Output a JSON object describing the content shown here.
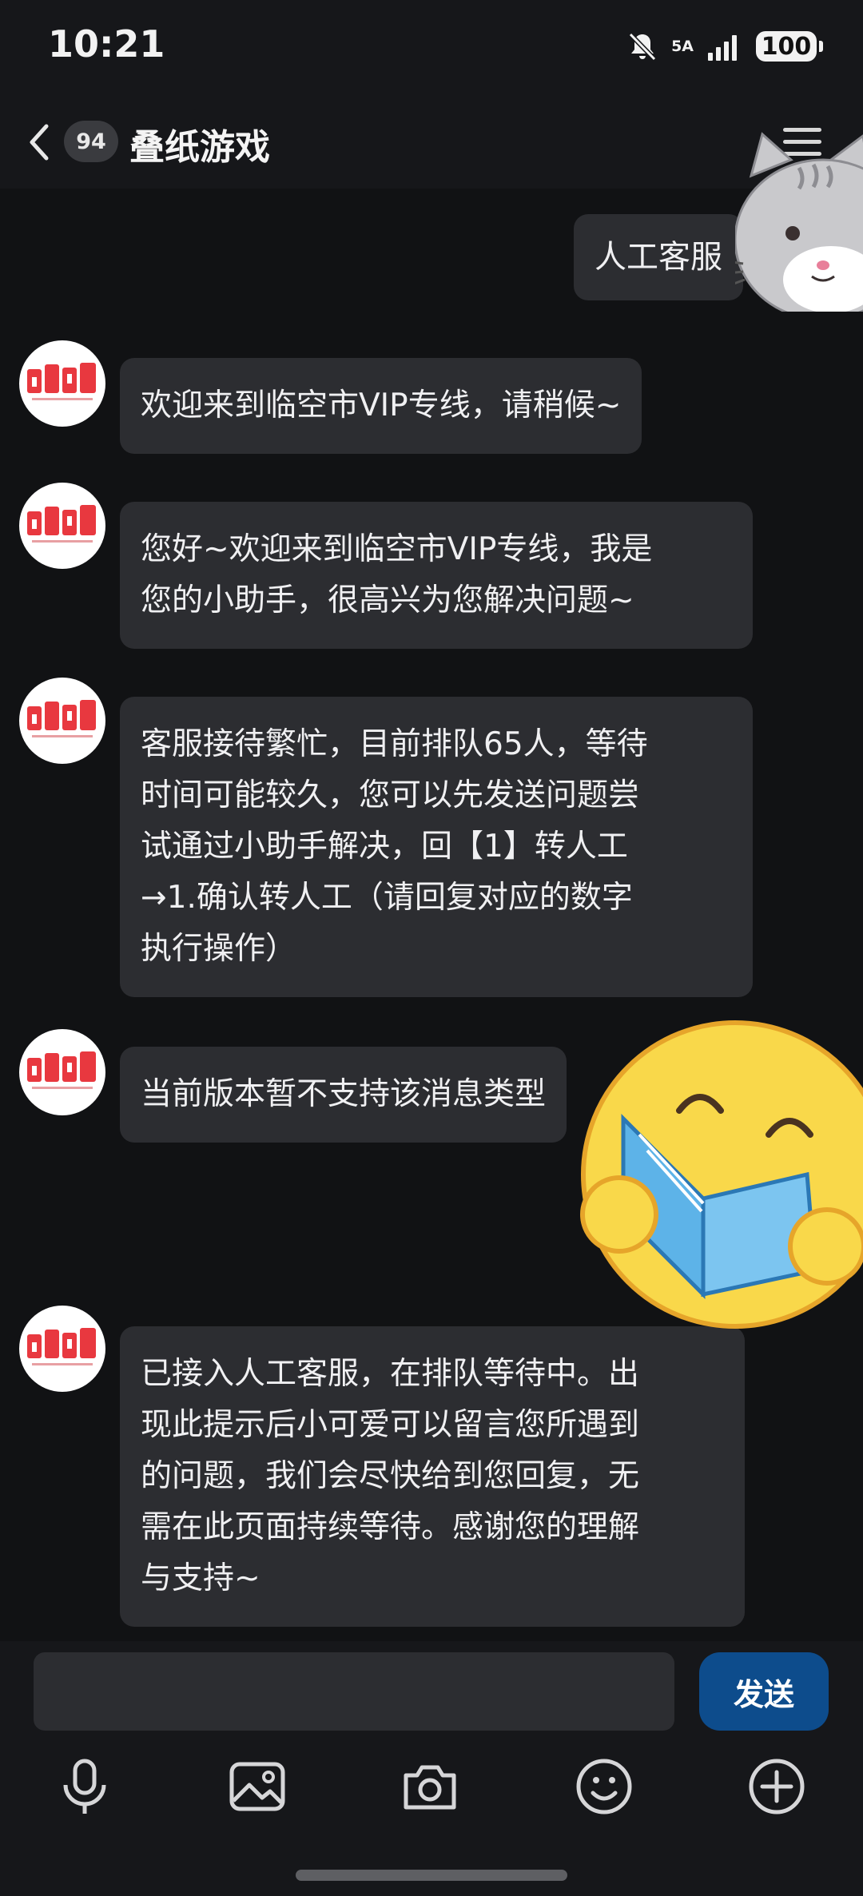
{
  "status_bar": {
    "time": "10:21",
    "network": "5A",
    "battery": "100",
    "icons": [
      "bell-mute-icon",
      "signal-icon",
      "battery-icon"
    ]
  },
  "header": {
    "unread_count": "94",
    "title": "叠纸游戏",
    "icons": [
      "back-arrow-icon",
      "menu-icon"
    ]
  },
  "messages": [
    {
      "direction": "out",
      "text": "人工客服"
    },
    {
      "direction": "in",
      "text": "欢迎来到临空市VIP专线，请稍候~"
    },
    {
      "direction": "in",
      "lines": [
        "您好~欢迎来到临空市VIP专线，我是",
        "您的小助手，很高兴为您解决问题~"
      ]
    },
    {
      "direction": "in",
      "lines": [
        "客服接待繁忙，目前排队65人，等待",
        "时间可能较久，您可以先发送问题尝",
        "试通过小助手解决，回【1】转人工",
        "→1.确认转人工（请回复对应的数字",
        "执行操作）"
      ]
    },
    {
      "direction": "in",
      "text": "当前版本暂不支持该消息类型"
    },
    {
      "direction": "in",
      "lines": [
        "已接入人工客服，在排队等待中。出",
        "现此提示后小可爱可以留言您所遇到",
        "的问题，我们会尽快给到您回复，无",
        "需在此页面持续等待。感谢您的理解",
        "与支持~"
      ]
    }
  ],
  "input_bar": {
    "input_value": "",
    "send_label": "发送",
    "tools": [
      "microphone-icon",
      "image-icon",
      "camera-icon",
      "emoji-icon",
      "plus-icon"
    ]
  },
  "colors": {
    "background": "#111214",
    "bar": "#16171a",
    "bubble": "#2c2d31",
    "send_button": "#0d4c8c",
    "avatar_brand": "#e8383f"
  },
  "stickers": [
    "cat-sticker",
    "reading-emoji-sticker"
  ]
}
